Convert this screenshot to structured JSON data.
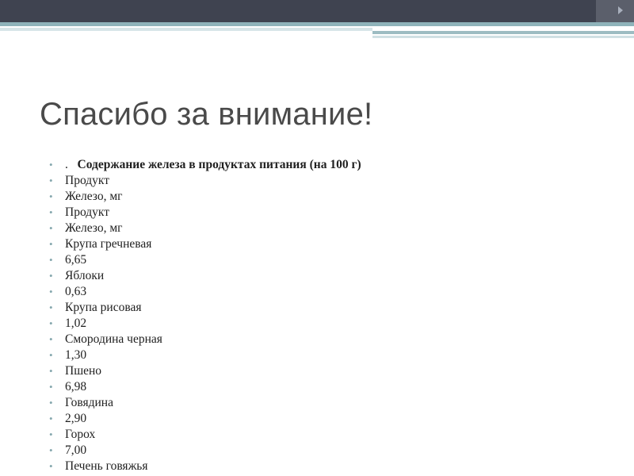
{
  "slide": {
    "title": "Спасибо за внимание!",
    "bullet_symbol": "•",
    "heading": {
      "lead": ".",
      "text": "Содержание железа в продуктах питания  (на 100 г)"
    },
    "items": [
      "Продукт",
      "Железо, мг",
      "Продукт",
      "Железо, мг",
      "Крупа гречневая",
      "6,65",
      "Яблоки",
      "0,63",
      "Крупа рисовая",
      "1,02",
      "Смородина черная",
      "1,30",
      "Пшено",
      "6,98",
      "Говядина",
      "2,90",
      "Горох",
      "7,00",
      "Печень говяжья"
    ]
  },
  "colors": {
    "top_bar": "#3f4350",
    "accent": "#8fb3ba",
    "bullet": "#86a8ae",
    "title": "#4a4a4a"
  }
}
